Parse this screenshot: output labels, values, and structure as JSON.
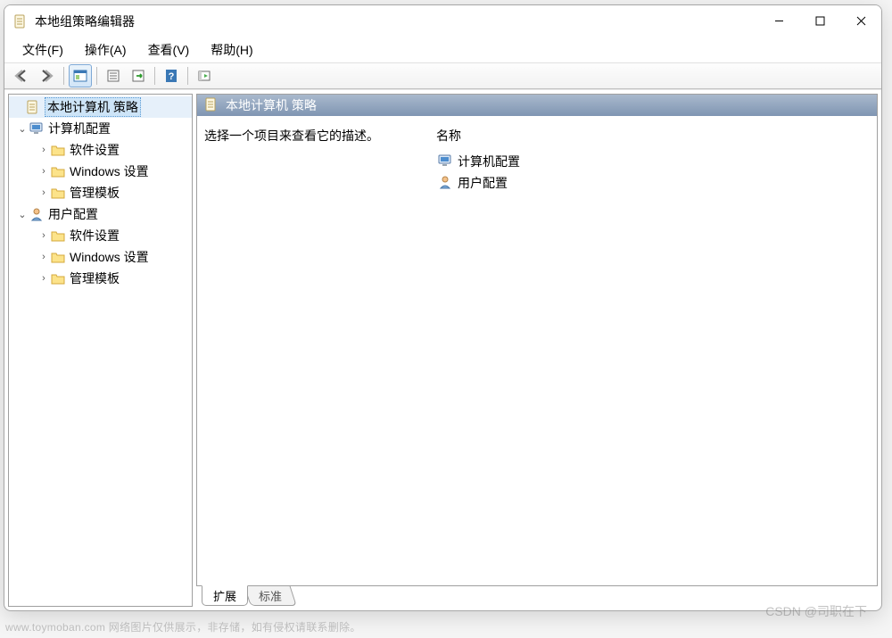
{
  "window": {
    "title": "本地组策略编辑器"
  },
  "menu": {
    "file": "文件(F)",
    "action": "操作(A)",
    "view": "查看(V)",
    "help": "帮助(H)"
  },
  "tree": {
    "root": "本地计算机 策略",
    "computer": "计算机配置",
    "computer_children": {
      "software": "软件设置",
      "windows": "Windows 设置",
      "templates": "管理模板"
    },
    "user": "用户配置",
    "user_children": {
      "software": "软件设置",
      "windows": "Windows 设置",
      "templates": "管理模板"
    }
  },
  "content": {
    "header": "本地计算机 策略",
    "description": "选择一个项目来查看它的描述。",
    "column_name": "名称",
    "items": {
      "computer": "计算机配置",
      "user": "用户配置"
    }
  },
  "tabs": {
    "extended": "扩展",
    "standard": "标准"
  },
  "footer": "www.toymoban.com 网络图片仅供展示，非存储，如有侵权请联系删除。",
  "watermark": "CSDN @司职在下"
}
